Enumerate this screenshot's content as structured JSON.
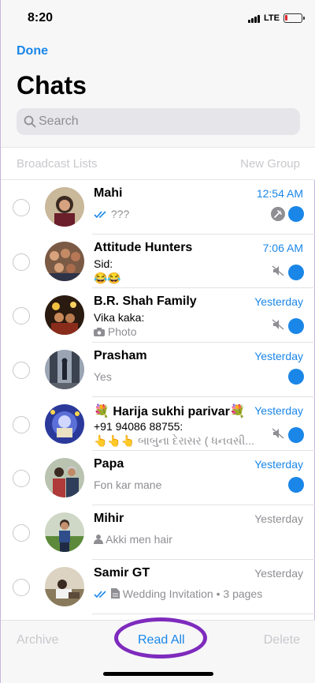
{
  "status_bar": {
    "time": "8:20",
    "network": "LTE"
  },
  "nav": {
    "done_label": "Done",
    "title": "Chats"
  },
  "search": {
    "placeholder": "Search"
  },
  "links": {
    "broadcast_lists": "Broadcast Lists",
    "new_group": "New Group"
  },
  "chats": [
    {
      "name": "Mahi",
      "time": "12:54 AM",
      "preview": "???",
      "ticks": "read",
      "pinned": true,
      "unread": true
    },
    {
      "name": "Attitude Hunters",
      "time": "7:06 AM",
      "sender": "Sid:",
      "preview": "😂😂",
      "muted": true,
      "unread": true
    },
    {
      "name": "B.R. Shah Family",
      "time": "Yesterday",
      "sender": "Vika kaka:",
      "preview": "Photo",
      "muted": true,
      "unread": true
    },
    {
      "name": "Prasham",
      "time": "Yesterday",
      "preview": "Yes",
      "unread": true
    },
    {
      "name": "💐 Harija sukhi parivar💐",
      "time": "Yesterday",
      "sender": "+91 94086 88755:",
      "preview": "👆👆👆 બાબુના દેરાસર ( ધનવસી...",
      "muted": true,
      "unread": true
    },
    {
      "name": "Papa",
      "time": "Yesterday",
      "preview": "Fon kar mane",
      "unread": true
    },
    {
      "name": "Mihir",
      "time": "Yesterday",
      "preview": "Akki men hair"
    },
    {
      "name": "Samir GT",
      "time": "Yesterday",
      "preview": "Wedding Invitation • 3 pages",
      "ticks": "read"
    }
  ],
  "toolbar": {
    "archive_label": "Archive",
    "read_all_label": "Read All",
    "delete_label": "Delete"
  },
  "colors": {
    "accent": "#1a86e8",
    "highlight_oval": "#7e2bbd",
    "muted_text": "#8e8e93"
  }
}
